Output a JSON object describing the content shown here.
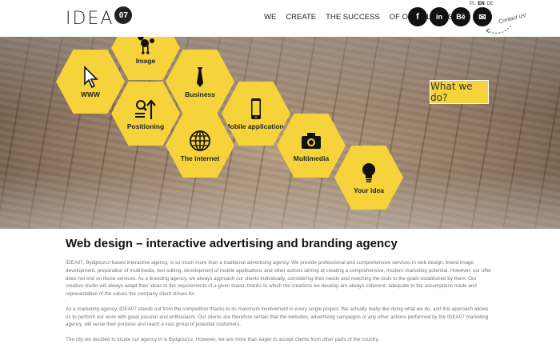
{
  "logo": {
    "text": "IDEA",
    "badge": "07"
  },
  "nav": [
    "WE",
    "CREATE",
    "THE SUCCESS",
    "OF OUR CLIENTS"
  ],
  "social": [
    {
      "name": "facebook",
      "glyph": "f"
    },
    {
      "name": "linkedin",
      "glyph": "in"
    },
    {
      "name": "behance",
      "glyph": "Bē"
    },
    {
      "name": "mail",
      "glyph": "✉"
    }
  ],
  "languages": [
    "PL",
    "EN",
    "DE"
  ],
  "active_language": "EN",
  "contact_hint": "Contact us!",
  "hero": {
    "cta": "What we do?",
    "hexes": [
      {
        "label": "Image",
        "icon": "poodle-icon"
      },
      {
        "label": "WWW",
        "icon": "cursor-icon"
      },
      {
        "label": "Business",
        "icon": "tie-icon"
      },
      {
        "label": "Positioning",
        "icon": "magnifier-arrow-icon"
      },
      {
        "label": "Mobile applications",
        "icon": "smartphone-icon"
      },
      {
        "label": "The internet",
        "icon": "globe-icon"
      },
      {
        "label": "Multimedia",
        "icon": "camera-icon"
      },
      {
        "label": "Your idea",
        "icon": "lightbulb-icon"
      }
    ]
  },
  "content": {
    "title": "Web design – interactive advertising and branding agency",
    "paragraphs": [
      "IDEA07, Bydgoszcz-based interactive agency, is so much more than a traditional advertising agency. We provide professional and comprehensive services in web design, brand image development, preparation of multimedia, text editing, development of mobile applications and other actions aiming at creating a comprehensive, modern marketing potential. However, our offer does not end on these services. As a branding agency, we always approach our clients individually, considering their needs and matching the tools to the goals established by them. Our creative studio will always adapt their ideas to the requirements of a given brand, thanks to which the creations we develop are always coherent, adequate to the assumptions made and representative of the values the company-client strives for.",
      "As a marketing agency, IDEA07 stands out from the competition thanks to its maximum involvement in every single project. We actually really like doing what we do, and this approach allows us to perform our work with great passion and enthusiasm. Our clients are therefore certain that the websites, advertising campaigns or any other actions performed by the IDEA07 marketing agency, will serve their purpose and reach a vast group of potential customers.",
      "The city we decided to locate our agency in is Bydgoszcz. However, we are more than eager to accept clients from other parts of the country."
    ]
  },
  "colors": {
    "accent": "#f6d33a",
    "dark": "#111111",
    "text_muted": "#777777"
  }
}
